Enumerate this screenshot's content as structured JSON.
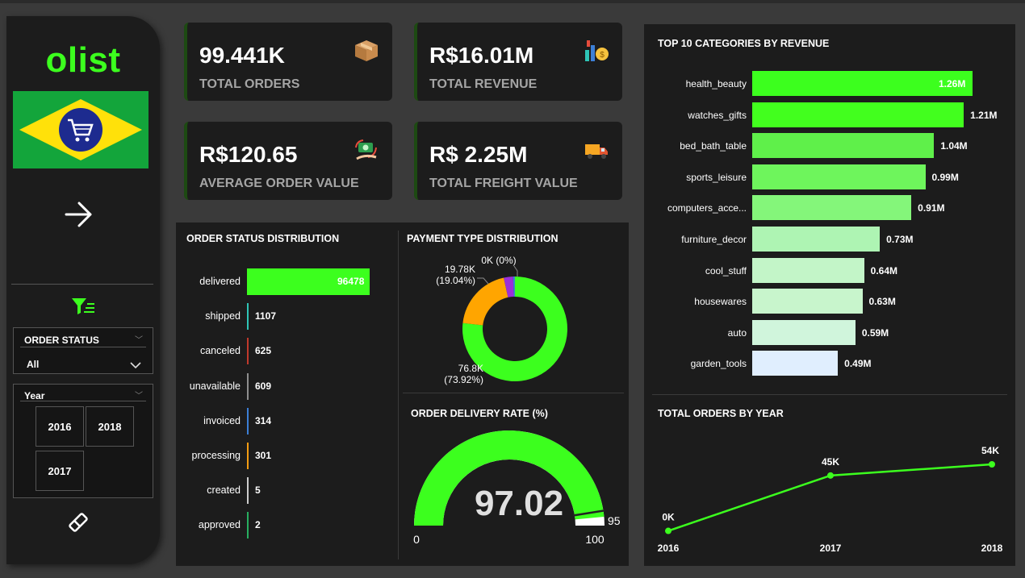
{
  "sidebar": {
    "logo": "olist",
    "order_status_slicer": {
      "title": "ORDER STATUS",
      "value": "All"
    },
    "year_slicer": {
      "title": "Year",
      "options": [
        "2016",
        "2018",
        "2017"
      ]
    }
  },
  "kpis": [
    {
      "value": "99.441K",
      "label": "TOTAL ORDERS",
      "icon": "package-icon"
    },
    {
      "value": "R$16.01M",
      "label": "TOTAL REVENUE",
      "icon": "revenue-icon"
    },
    {
      "value": "R$120.65",
      "label": "AVERAGE ORDER VALUE",
      "icon": "money-exchange-icon"
    },
    {
      "value": "R$ 2.25M",
      "label": "TOTAL FREIGHT VALUE",
      "icon": "delivery-truck-icon"
    }
  ],
  "order_status": {
    "title": "ORDER STATUS DISTRIBUTION",
    "chart_data": {
      "type": "bar",
      "orientation": "horizontal",
      "categories": [
        "delivered",
        "shipped",
        "canceled",
        "unavailable",
        "invoiced",
        "processing",
        "created",
        "approved"
      ],
      "values": [
        96478,
        1107,
        625,
        609,
        314,
        301,
        5,
        2
      ],
      "labels": [
        "96478",
        "1107",
        "625",
        "609",
        "314",
        "301",
        "5",
        "2"
      ],
      "colors": [
        "#3cff1e",
        "#2ec4b6",
        "#c0392b",
        "#8e8e8e",
        "#3c7fd6",
        "#f39c12",
        "#cccccc",
        "#27ae60"
      ]
    }
  },
  "payment_type": {
    "title": "PAYMENT TYPE DISTRIBUTION",
    "chart_data": {
      "type": "pie",
      "style": "donut",
      "values": [
        76.8,
        19.78,
        2.87,
        0.56
      ],
      "colors": [
        "#3cff1e",
        "#ffa500",
        "#9b30d9",
        "#3c7fd6"
      ],
      "labels": [
        {
          "value": "76.8K",
          "pct": "(73.92%)"
        },
        {
          "value": "19.78K",
          "pct": "(19.04%)"
        },
        {
          "value": "0K (0%)",
          "pct": ""
        }
      ]
    }
  },
  "delivery_rate": {
    "title": "ORDER DELIVERY RATE (%)",
    "chart_data": {
      "type": "gauge",
      "value": 97.02,
      "value_label": "97.02",
      "min": 0,
      "max": 100,
      "target": 95,
      "min_label": "0",
      "max_label": "100",
      "target_label": "95",
      "color": "#3cff1e"
    }
  },
  "top_categories": {
    "title": "TOP 10 CATEGORIES BY REVENUE",
    "chart_data": {
      "type": "bar",
      "orientation": "horizontal",
      "categories": [
        "health_beauty",
        "watches_gifts",
        "bed_bath_table",
        "sports_leisure",
        "computers_acce...",
        "furniture_decor",
        "cool_stuff",
        "housewares",
        "auto",
        "garden_tools"
      ],
      "values": [
        1.26,
        1.21,
        1.04,
        0.99,
        0.91,
        0.73,
        0.64,
        0.63,
        0.59,
        0.49
      ],
      "labels": [
        "1.26M",
        "1.21M",
        "1.04M",
        "0.99M",
        "0.91M",
        "0.73M",
        "0.64M",
        "0.63M",
        "0.59M",
        "0.49M"
      ],
      "colors": [
        "#3cff1e",
        "#42ff1e",
        "#5ff04a",
        "#6ef55c",
        "#84f67a",
        "#aef4b3",
        "#c3f5c8",
        "#c8f5cc",
        "#d0f5dc",
        "#e0eefe"
      ]
    }
  },
  "orders_by_year": {
    "title": "TOTAL ORDERS BY YEAR",
    "chart_data": {
      "type": "line",
      "x": [
        "2016",
        "2017",
        "2018"
      ],
      "values": [
        0.3,
        45,
        54
      ],
      "labels": [
        "0K",
        "45K",
        "54K"
      ],
      "color": "#3cff1e"
    }
  }
}
